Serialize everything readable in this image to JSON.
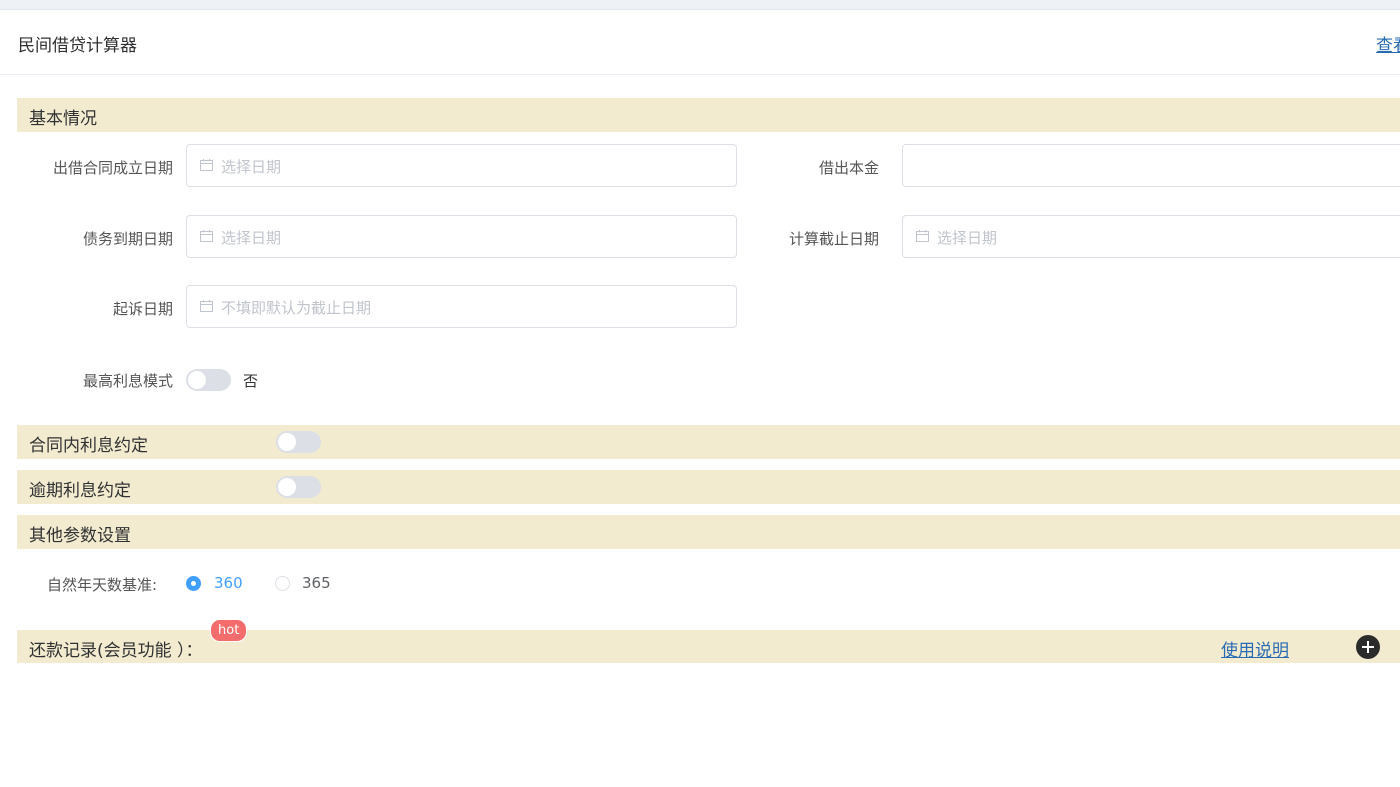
{
  "header": {
    "title": "民间借贷计算器",
    "right_link": "查看"
  },
  "sections": {
    "basic": "基本情况",
    "contract_interest": "合同内利息约定",
    "overdue_interest": "逾期利息约定",
    "other_params": "其他参数设置",
    "repayment": "还款记录(会员功能 ）："
  },
  "fields": {
    "contract_date": {
      "label": "出借合同成立日期",
      "placeholder": "选择日期",
      "icon": "calendar-icon"
    },
    "principal": {
      "label": "借出本金",
      "value": ""
    },
    "due_date": {
      "label": "债务到期日期",
      "placeholder": "选择日期",
      "icon": "calendar-icon"
    },
    "calc_end_date": {
      "label": "计算截止日期",
      "placeholder": "选择日期",
      "icon": "calendar-icon"
    },
    "lawsuit_date": {
      "label": "起诉日期",
      "placeholder": "不填即默认为截止日期",
      "icon": "calendar-icon"
    },
    "max_interest_mode": {
      "label": "最高利息模式",
      "state_text": "否",
      "on": false
    }
  },
  "toggles": {
    "contract_interest_on": false,
    "overdue_interest_on": false
  },
  "year_basis": {
    "label": "自然年天数基准:",
    "options": [
      "360",
      "365"
    ],
    "selected": "360"
  },
  "badge": {
    "hot": "hot"
  },
  "repayment_actions": {
    "usage_link": "使用说明",
    "add_icon": "plus-circle-icon"
  },
  "colors": {
    "section_bg": "#f2ebcf",
    "link": "#2a6cb3",
    "primary": "#409eff",
    "hot_badge": "#f56c6c"
  }
}
